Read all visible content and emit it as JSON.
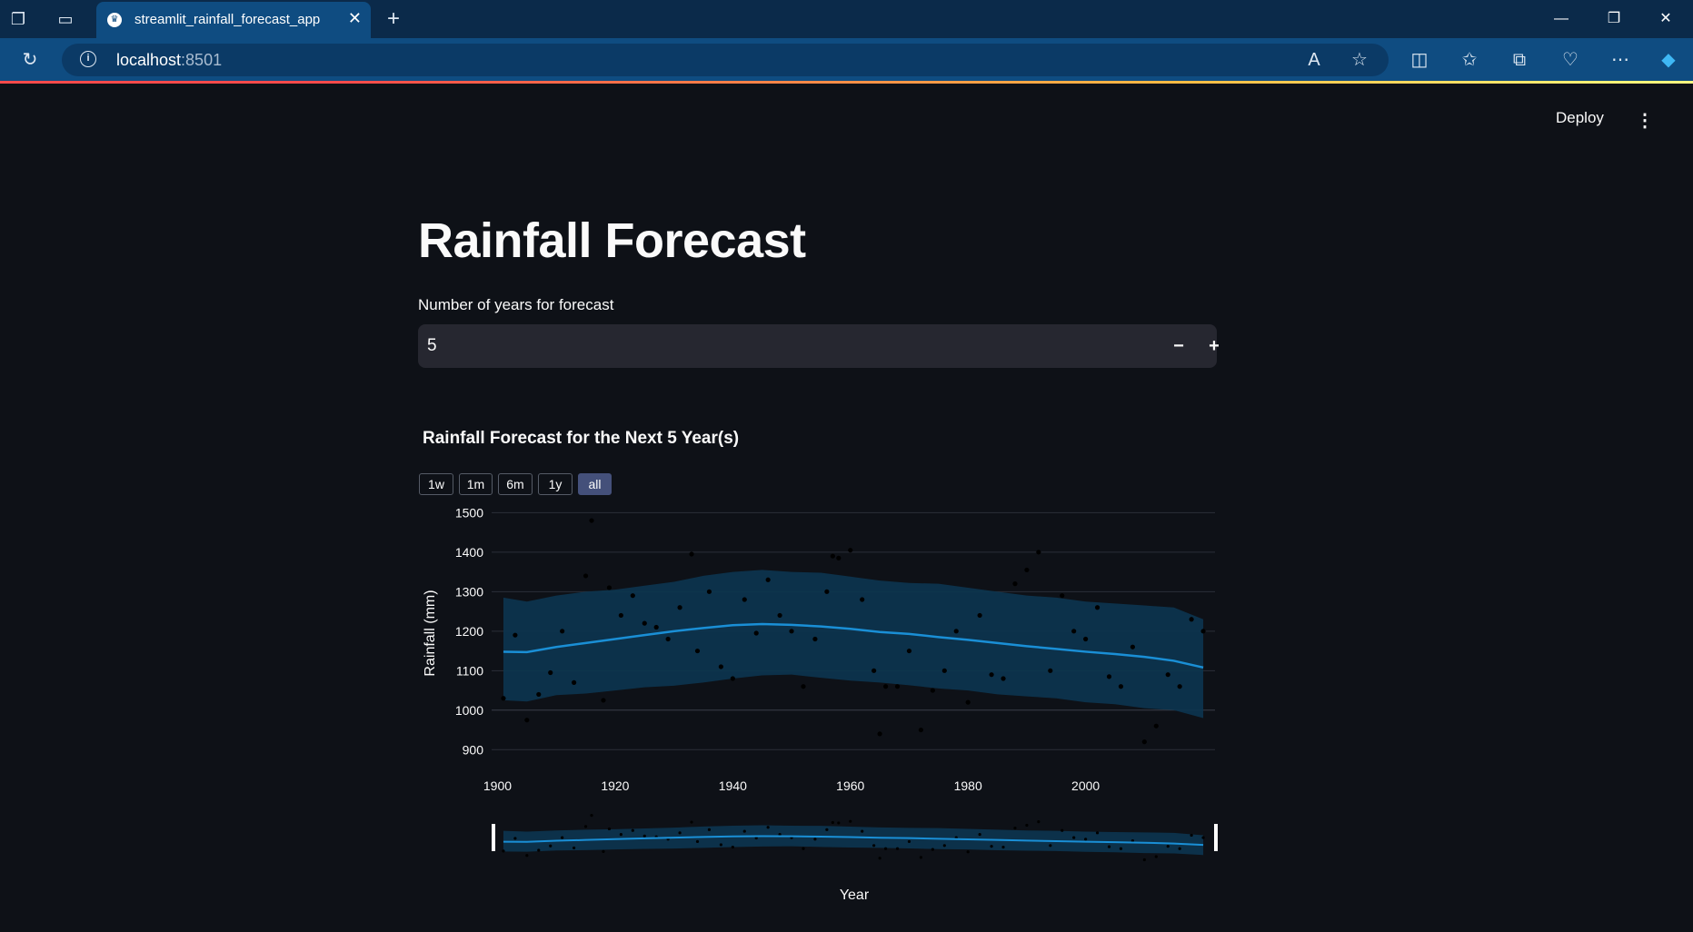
{
  "browser": {
    "tab_title": "streamlit_rainfall_forecast_app",
    "url_host": "localhost",
    "url_port": ":8501",
    "icons": [
      "workspaces-icon",
      "tab-actions-icon",
      "refresh-icon",
      "site-info-icon",
      "read-aloud-icon",
      "favorite-star-icon",
      "split-screen-icon",
      "favorites-icon",
      "collections-icon",
      "browser-essentials-icon",
      "more-icon",
      "copilot-icon"
    ]
  },
  "app": {
    "deploy_label": "Deploy",
    "title": "Rainfall Forecast",
    "input_label": "Number of years for forecast",
    "input_value": "5",
    "minus": "−",
    "plus": "+"
  },
  "chart_data": {
    "type": "line",
    "title": "Rainfall Forecast for the Next 5 Year(s)",
    "xlabel": "Year",
    "ylabel": "Rainfall (mm)",
    "xlim": [
      1899,
      2022
    ],
    "ylim": [
      880,
      1510
    ],
    "x_ticks": [
      1900,
      1920,
      1940,
      1960,
      1980,
      2000
    ],
    "y_ticks": [
      900,
      1000,
      1100,
      1200,
      1300,
      1400,
      1500
    ],
    "range_buttons": [
      "1w",
      "1m",
      "6m",
      "1y",
      "all"
    ],
    "active_range": "all",
    "colors": {
      "forecast": "#1a8fd6",
      "band": "#0c3550",
      "points": "#000000",
      "grid": "#2b2f38"
    },
    "forecast": {
      "x": [
        1901,
        1905,
        1910,
        1915,
        1920,
        1925,
        1930,
        1935,
        1940,
        1945,
        1950,
        1955,
        1960,
        1965,
        1970,
        1975,
        1980,
        1985,
        1990,
        1995,
        2000,
        2005,
        2010,
        2015,
        2020
      ],
      "yhat": [
        1148,
        1147,
        1160,
        1170,
        1180,
        1190,
        1200,
        1208,
        1215,
        1218,
        1216,
        1212,
        1206,
        1198,
        1193,
        1185,
        1178,
        1170,
        1162,
        1155,
        1148,
        1142,
        1135,
        1125,
        1108
      ],
      "lower": [
        1025,
        1022,
        1038,
        1042,
        1050,
        1058,
        1062,
        1070,
        1080,
        1088,
        1090,
        1082,
        1075,
        1070,
        1063,
        1055,
        1050,
        1040,
        1035,
        1030,
        1020,
        1015,
        1005,
        1000,
        980
      ],
      "upper": [
        1285,
        1275,
        1290,
        1300,
        1305,
        1315,
        1325,
        1340,
        1350,
        1355,
        1350,
        1348,
        1338,
        1328,
        1322,
        1320,
        1310,
        1300,
        1290,
        1285,
        1275,
        1270,
        1265,
        1260,
        1230
      ]
    },
    "observed": {
      "x": [
        1901,
        1903,
        1905,
        1907,
        1909,
        1911,
        1913,
        1915,
        1916,
        1918,
        1919,
        1921,
        1923,
        1925,
        1927,
        1929,
        1931,
        1933,
        1934,
        1936,
        1938,
        1940,
        1942,
        1944,
        1946,
        1948,
        1950,
        1952,
        1954,
        1956,
        1957,
        1958,
        1960,
        1962,
        1964,
        1965,
        1966,
        1968,
        1970,
        1972,
        1974,
        1976,
        1978,
        1980,
        1982,
        1984,
        1986,
        1988,
        1990,
        1992,
        1994,
        1996,
        1998,
        2000,
        2002,
        2004,
        2006,
        2008,
        2010,
        2012,
        2014,
        2016,
        2018,
        2020
      ],
      "y": [
        1030,
        1190,
        975,
        1040,
        1095,
        1200,
        1070,
        1340,
        1480,
        1025,
        1310,
        1240,
        1290,
        1220,
        1210,
        1180,
        1260,
        1395,
        1150,
        1300,
        1110,
        1080,
        1280,
        1195,
        1330,
        1240,
        1200,
        1060,
        1180,
        1300,
        1390,
        1385,
        1405,
        1280,
        1100,
        940,
        1060,
        1060,
        1150,
        950,
        1050,
        1100,
        1200,
        1020,
        1240,
        1090,
        1080,
        1320,
        1355,
        1400,
        1100,
        1290,
        1200,
        1180,
        1260,
        1085,
        1060,
        1160,
        920,
        960,
        1090,
        1060,
        1230,
        1200
      ]
    }
  }
}
